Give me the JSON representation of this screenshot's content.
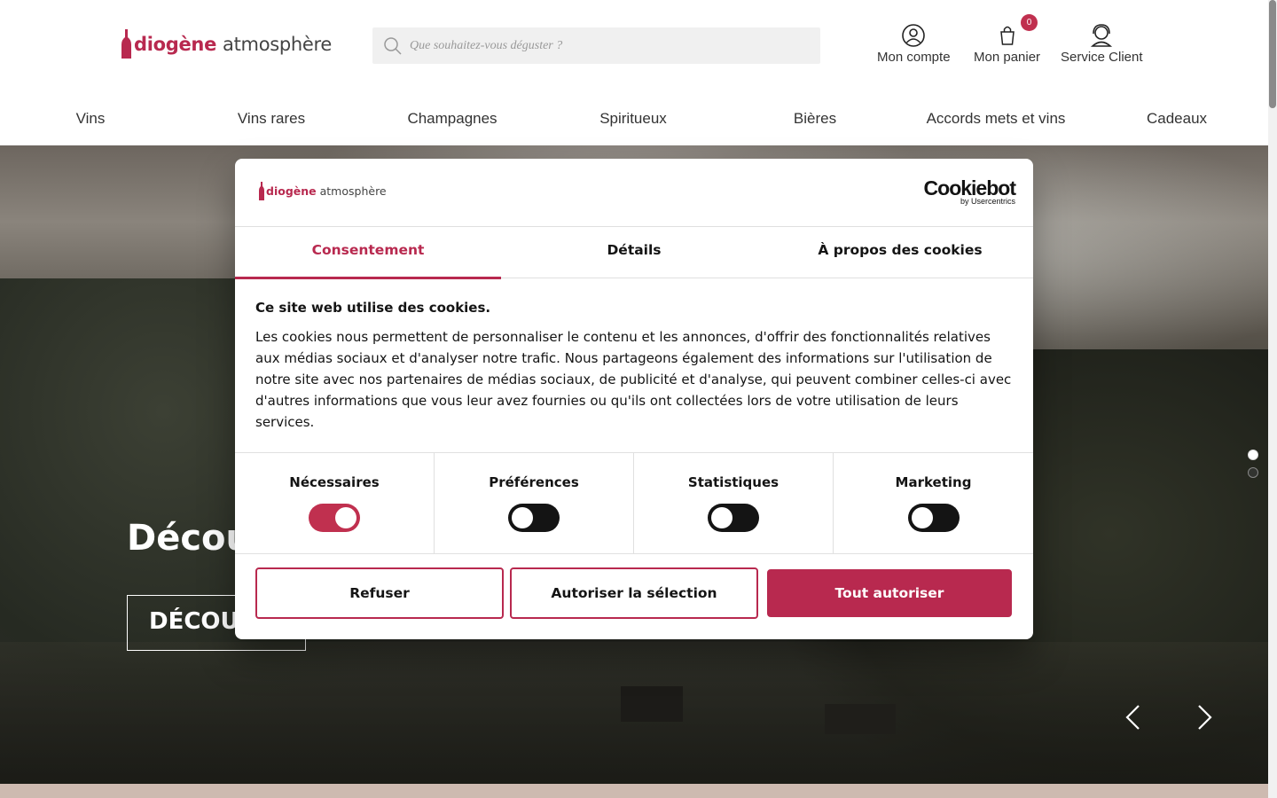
{
  "header": {
    "logo": {
      "brand_bold": "diogène",
      "brand_light": "atmosphère"
    },
    "search": {
      "placeholder": "Que souhaitez-vous déguster ?",
      "value": ""
    },
    "actions": {
      "account": "Mon compte",
      "cart": "Mon panier",
      "cart_count": "0",
      "support": "Service Client"
    },
    "nav": [
      "Vins",
      "Vins rares",
      "Champagnes",
      "Spiritueux",
      "Bières",
      "Accords mets et vins",
      "Cadeaux"
    ]
  },
  "hero": {
    "title": "Découv",
    "button": "DÉCOUV"
  },
  "cookie_dialog": {
    "logo": {
      "brand_bold": "diogène",
      "brand_light": "atmosphère"
    },
    "provider": {
      "name": "Cookiebot",
      "by": "by Usercentrics"
    },
    "tabs": [
      {
        "label": "Consentement",
        "active": true
      },
      {
        "label": "Détails",
        "active": false
      },
      {
        "label": "À propos des cookies",
        "active": false
      }
    ],
    "title": "Ce site web utilise des cookies.",
    "text": "Les cookies nous permettent de personnaliser le contenu et les annonces, d'offrir des fonctionnalités relatives aux médias sociaux et d'analyser notre trafic. Nous partageons également des informations sur l'utilisation de notre site avec nos partenaires de médias sociaux, de publicité et d'analyse, qui peuvent combiner celles-ci avec d'autres informations que vous leur avez fournies ou qu'ils ont collectées lors de votre utilisation de leurs services.",
    "categories": [
      {
        "label": "Nécessaires",
        "enabled": true
      },
      {
        "label": "Préférences",
        "enabled": false
      },
      {
        "label": "Statistiques",
        "enabled": false
      },
      {
        "label": "Marketing",
        "enabled": false
      }
    ],
    "buttons": {
      "reject": "Refuser",
      "allow_selection": "Autoriser la sélection",
      "allow_all": "Tout autoriser"
    }
  },
  "colors": {
    "brand": "#b8294f",
    "badge": "#c0304f",
    "toggle_off": "#141414"
  }
}
